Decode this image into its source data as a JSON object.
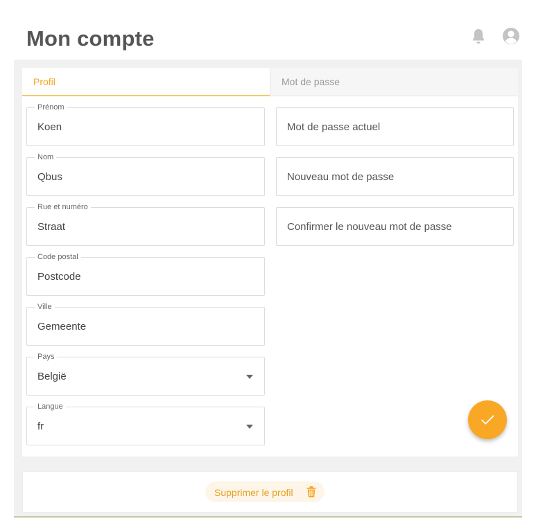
{
  "header": {
    "title": "Mon compte",
    "bell_icon": "bell-icon",
    "user_icon": "user-circle-icon"
  },
  "tabs": [
    {
      "label": "Profil",
      "active": true
    },
    {
      "label": "Mot de passe",
      "active": false
    }
  ],
  "profile": {
    "first_name": {
      "label": "Prénom",
      "value": "Koen"
    },
    "last_name": {
      "label": "Nom",
      "value": "Qbus"
    },
    "street": {
      "label": "Rue et numéro",
      "value": "Straat"
    },
    "postal_code": {
      "label": "Code postal",
      "value": "Postcode"
    },
    "city": {
      "label": "Ville",
      "value": "Gemeente"
    },
    "country": {
      "label": "Pays",
      "value": "België"
    },
    "language": {
      "label": "Langue",
      "value": "fr"
    }
  },
  "password": {
    "current": {
      "placeholder": "Mot de passe actuel"
    },
    "new": {
      "placeholder": "Nouveau mot de passe"
    },
    "confirm": {
      "placeholder": "Confirmer le nouveau mot de passe"
    }
  },
  "actions": {
    "delete_label": "Supprimer le profil",
    "delete_icon": "trash-icon",
    "save_icon": "check-icon"
  },
  "colors": {
    "accent": "#f9a825",
    "accent_text": "#e7a022",
    "accent_bg": "#fdf6e8"
  }
}
